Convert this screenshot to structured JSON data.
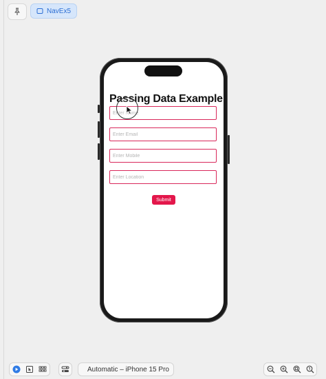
{
  "toolbar": {
    "tab_label": "NavEx5"
  },
  "app": {
    "title": "Passing Data Example",
    "fields": [
      {
        "placeholder": "Enter Name"
      },
      {
        "placeholder": "Enter Email"
      },
      {
        "placeholder": "Enter Mobile"
      },
      {
        "placeholder": "Enter Location"
      }
    ],
    "submit_label": "Submit"
  },
  "bottom_bar": {
    "device_label": "Automatic – iPhone 15 Pro"
  },
  "colors": {
    "accent": "#e3174b",
    "field_border": "#d9275a",
    "tab_bg": "#d6e6fb",
    "tab_text": "#2d6fd4"
  },
  "icons": [
    "pin-icon",
    "device-frame-icon",
    "play-icon",
    "select-icon",
    "grid-icon",
    "settings-icon",
    "phone-icon",
    "chevron-down-icon",
    "zoom-out-icon",
    "zoom-in-icon",
    "zoom-fit-icon",
    "zoom-actual-icon"
  ]
}
